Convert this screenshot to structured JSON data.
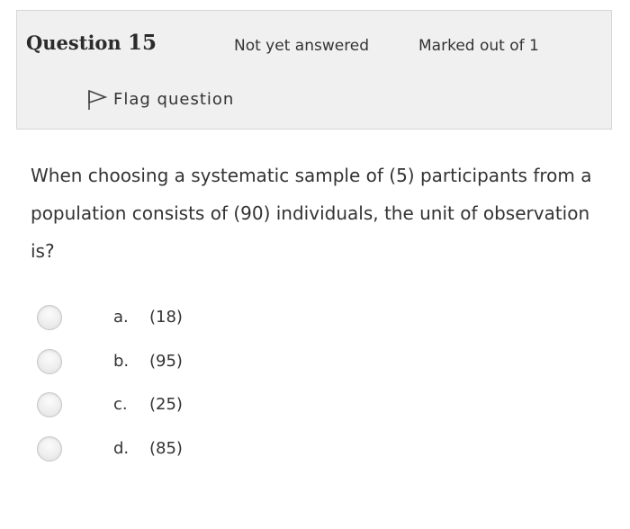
{
  "header": {
    "question_word": "Question",
    "question_number": "15",
    "state": "Not yet answered",
    "grade": "Marked out of 1",
    "flag_label": "Flag question",
    "flag_icon": "flag-icon"
  },
  "question": {
    "text": "When choosing a systematic sample of (5) participants from a population consists of (90) individuals, the unit of observation is?"
  },
  "answers": [
    {
      "letter": "a.",
      "text": "(18)",
      "selected": false
    },
    {
      "letter": "b.",
      "text": "(95)",
      "selected": false
    },
    {
      "letter": "c.",
      "text": "(25)",
      "selected": false
    },
    {
      "letter": "d.",
      "text": "(85)",
      "selected": false
    }
  ],
  "colors": {
    "info_background": "#f0f0f0",
    "info_border": "#d6d6d6",
    "text": "#333333"
  }
}
